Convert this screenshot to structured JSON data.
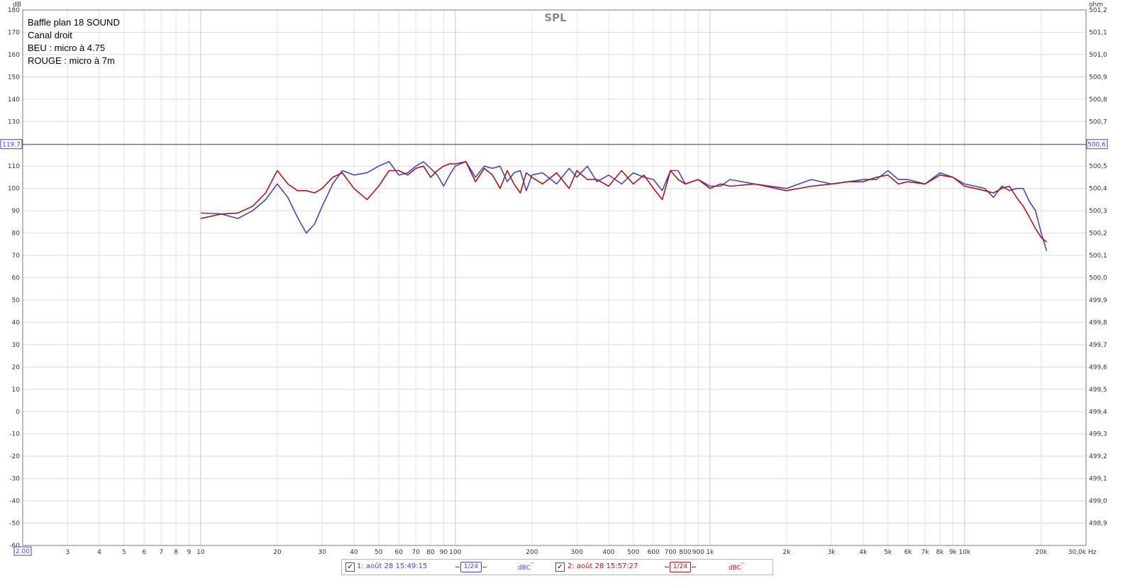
{
  "chart_data": {
    "type": "line",
    "title": "SPL",
    "notes": [
      "Baffle plan 18 SOUND",
      "Canal droit",
      "BEU : micro à 4.75",
      "ROUGE : micro à 7m"
    ],
    "x_scale": "log",
    "xlim": [
      2,
      30000
    ],
    "ylim": [
      -60,
      180
    ],
    "ylabel": "dB",
    "y2label": "ohm",
    "y2lim": [
      498.8,
      501.2
    ],
    "xunit": "Hz",
    "y_ticks": [
      -60,
      -50,
      -40,
      -30,
      -20,
      -10,
      0,
      10,
      20,
      30,
      40,
      50,
      60,
      70,
      80,
      90,
      100,
      110,
      120,
      130,
      140,
      150,
      160,
      170,
      180
    ],
    "y_tick_labels": [
      "-60",
      "-50",
      "-40",
      "-30",
      "-20",
      "-10",
      "0",
      "10",
      "20",
      "30",
      "40",
      "50",
      "60",
      "70",
      "80",
      "90",
      "100",
      "110",
      "",
      "130",
      "140",
      "150",
      "160",
      "170",
      "180"
    ],
    "y2_tick_labels": [
      "",
      "498,9",
      "499,0",
      "499,1",
      "499,2",
      "499,3",
      "499,4",
      "499,5",
      "499,6",
      "499,7",
      "499,8",
      "499,9",
      "500,0",
      "500,1",
      "500,2",
      "500,3",
      "500,4",
      "500,5",
      "",
      "500,7",
      "500,8",
      "500,9",
      "501,0",
      "501,1",
      "501,2"
    ],
    "x_ticks": [
      {
        "v": 3,
        "t": "3"
      },
      {
        "v": 4,
        "t": "4"
      },
      {
        "v": 5,
        "t": "5"
      },
      {
        "v": 6,
        "t": "6"
      },
      {
        "v": 7,
        "t": "7"
      },
      {
        "v": 8,
        "t": "8"
      },
      {
        "v": 9,
        "t": "9"
      },
      {
        "v": 10,
        "t": "10"
      },
      {
        "v": 20,
        "t": "20"
      },
      {
        "v": 30,
        "t": "30"
      },
      {
        "v": 40,
        "t": "40"
      },
      {
        "v": 50,
        "t": "50"
      },
      {
        "v": 60,
        "t": "60"
      },
      {
        "v": 70,
        "t": "70"
      },
      {
        "v": 80,
        "t": "80"
      },
      {
        "v": 90,
        "t": "90"
      },
      {
        "v": 100,
        "t": "100"
      },
      {
        "v": 200,
        "t": "200"
      },
      {
        "v": 300,
        "t": "300"
      },
      {
        "v": 400,
        "t": "400"
      },
      {
        "v": 500,
        "t": "500"
      },
      {
        "v": 600,
        "t": "600"
      },
      {
        "v": 700,
        "t": "700"
      },
      {
        "v": 800,
        "t": "800"
      },
      {
        "v": 900,
        "t": "900"
      },
      {
        "v": 1000,
        "t": "1k"
      },
      {
        "v": 2000,
        "t": "2k"
      },
      {
        "v": 3000,
        "t": "3k"
      },
      {
        "v": 4000,
        "t": "4k"
      },
      {
        "v": 5000,
        "t": "5k"
      },
      {
        "v": 6000,
        "t": "6k"
      },
      {
        "v": 7000,
        "t": "7k"
      },
      {
        "v": 8000,
        "t": "8k"
      },
      {
        "v": 9000,
        "t": "9k"
      },
      {
        "v": 10000,
        "t": "10k"
      },
      {
        "v": 20000,
        "t": "20k"
      }
    ],
    "x_start_label": "2.00",
    "x_end_label": "30,0k",
    "cursor": {
      "y": 119.7,
      "label_left": "119.7",
      "label_right": "500,6"
    },
    "series": [
      {
        "name": "1: août 28 15:49:15",
        "color": "#4a44b4",
        "x": [
          10,
          12,
          14,
          16,
          18,
          20,
          22,
          24,
          26,
          28,
          30,
          33,
          36,
          40,
          45,
          50,
          55,
          60,
          65,
          70,
          75,
          80,
          85,
          90,
          95,
          100,
          110,
          120,
          130,
          140,
          150,
          160,
          170,
          180,
          190,
          200,
          220,
          250,
          280,
          300,
          330,
          360,
          400,
          450,
          500,
          550,
          600,
          650,
          700,
          750,
          800,
          900,
          1000,
          1100,
          1200,
          1500,
          2000,
          2500,
          3000,
          3500,
          4000,
          4500,
          5000,
          5500,
          6000,
          7000,
          8000,
          9000,
          10000,
          11000,
          12000,
          13000,
          14000,
          15000,
          16000,
          17000,
          18000,
          19000,
          20000,
          21000
        ],
        "y": [
          89,
          88.6,
          86.5,
          90,
          95,
          102,
          96,
          87,
          80,
          84,
          92,
          102,
          108,
          106,
          107,
          110,
          112,
          106,
          107,
          110,
          112,
          109,
          106,
          101,
          106,
          110,
          112,
          105,
          110,
          109,
          110,
          103,
          107,
          108,
          99,
          106,
          107,
          102,
          109,
          105,
          110,
          103,
          106,
          102,
          107,
          105,
          104,
          99,
          108,
          108,
          102,
          104,
          101,
          101,
          104,
          102,
          100,
          104,
          102,
          103,
          104,
          104,
          108,
          104,
          104,
          102,
          107,
          105,
          102,
          101,
          100,
          96,
          101,
          99,
          100,
          100,
          94,
          90,
          80,
          72
        ]
      },
      {
        "name": "2: août 28 15:57:27",
        "color": "#a01818",
        "x": [
          10,
          12,
          14,
          16,
          18,
          20,
          22,
          24,
          26,
          28,
          30,
          33,
          36,
          40,
          45,
          50,
          55,
          60,
          65,
          70,
          75,
          80,
          85,
          90,
          95,
          100,
          110,
          120,
          130,
          140,
          150,
          160,
          170,
          180,
          190,
          200,
          220,
          250,
          280,
          300,
          330,
          360,
          400,
          450,
          500,
          550,
          600,
          650,
          700,
          750,
          800,
          900,
          1000,
          1100,
          1200,
          1500,
          2000,
          2500,
          3000,
          3500,
          4000,
          4500,
          5000,
          5500,
          6000,
          7000,
          8000,
          9000,
          10000,
          11000,
          12000,
          13000,
          14000,
          15000,
          16000,
          17000,
          18000,
          19000,
          20000,
          21000
        ],
        "y": [
          86.5,
          88.5,
          89,
          92,
          98,
          108,
          102,
          99,
          99,
          98,
          100,
          105,
          107,
          100,
          95,
          101,
          108,
          108,
          106,
          109,
          110,
          105,
          108,
          110,
          111,
          111,
          112,
          103,
          109,
          106,
          100,
          108,
          102,
          98,
          107,
          105,
          102,
          107,
          100,
          108,
          104,
          104,
          101,
          108,
          102,
          106,
          100,
          95,
          108,
          104,
          102,
          104,
          100,
          102,
          101,
          102,
          99,
          101,
          102,
          103,
          103,
          105,
          106,
          102,
          103,
          102,
          106,
          105,
          101,
          100,
          99,
          98,
          100,
          101,
          96,
          92,
          87,
          82,
          78,
          76
        ]
      }
    ]
  },
  "legend": {
    "items": [
      {
        "label": "1: août 28 15:49:15",
        "smoothing": "1/24",
        "unit": "dBC",
        "color": "#4a44b4"
      },
      {
        "label": "2: août 28 15:57:27",
        "smoothing": "1/24",
        "unit": "dBC",
        "color": "#a01818"
      }
    ],
    "checkbox": "✓",
    "unit_suffix": "''"
  }
}
